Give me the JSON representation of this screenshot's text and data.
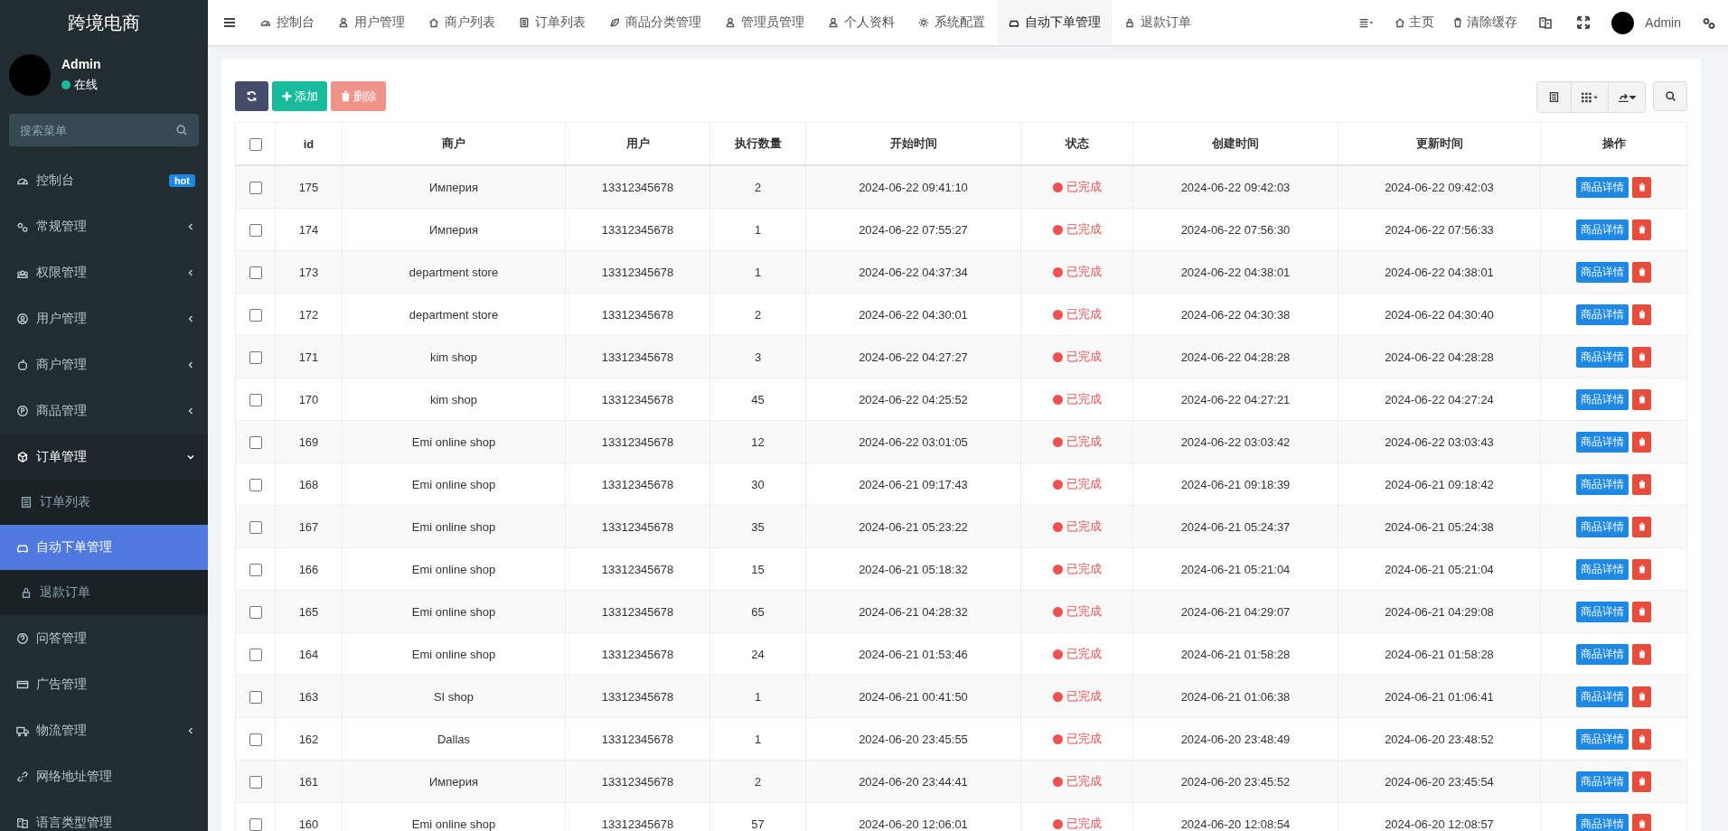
{
  "sidebar": {
    "logo": "跨境电商",
    "user": {
      "name": "Admin",
      "status": "在线",
      "online": true
    },
    "search": {
      "placeholder": "搜索菜单"
    },
    "items": [
      {
        "label": "控制台",
        "kind": "link",
        "badge": "hot"
      },
      {
        "label": "常规管理",
        "kind": "group",
        "expanded": false
      },
      {
        "label": "权限管理",
        "kind": "group",
        "expanded": false
      },
      {
        "label": "用户管理",
        "kind": "group",
        "expanded": false
      },
      {
        "label": "商户管理",
        "kind": "group",
        "expanded": false
      },
      {
        "label": "商品管理",
        "kind": "group",
        "expanded": false
      },
      {
        "label": "订单管理",
        "kind": "group",
        "expanded": true,
        "children": [
          {
            "label": "订单列表",
            "selected": false
          },
          {
            "label": "自动下单管理",
            "selected": true
          },
          {
            "label": "退款订单",
            "selected": false
          }
        ]
      },
      {
        "label": "问答管理",
        "kind": "link"
      },
      {
        "label": "广告管理",
        "kind": "link"
      },
      {
        "label": "物流管理",
        "kind": "group",
        "expanded": false
      },
      {
        "label": "网络地址管理",
        "kind": "link"
      },
      {
        "label": "语言类型管理",
        "kind": "link"
      }
    ]
  },
  "tabs": [
    {
      "label": "控制台",
      "selected": false
    },
    {
      "label": "用户管理",
      "selected": false
    },
    {
      "label": "商户列表",
      "selected": false
    },
    {
      "label": "订单列表",
      "selected": false
    },
    {
      "label": "商品分类管理",
      "selected": false
    },
    {
      "label": "管理员管理",
      "selected": false
    },
    {
      "label": "个人资料",
      "selected": false
    },
    {
      "label": "系统配置",
      "selected": false
    },
    {
      "label": "自动下单管理",
      "selected": true
    },
    {
      "label": "退款订单",
      "selected": false
    }
  ],
  "topbar": {
    "home": "主页",
    "clear_cache": "清除缓存",
    "user": "Admin"
  },
  "toolbar": {
    "add": "添加",
    "delete": {
      "label": "删除",
      "disabled": true
    }
  },
  "table": {
    "all_selected": false,
    "columns": [
      "id",
      "商户",
      "用户",
      "执行数量",
      "开始时间",
      "状态",
      "创建时间",
      "更新时间",
      "操作"
    ],
    "rows": [
      {
        "selected": false,
        "id": "175",
        "merchant": "Империя",
        "user": "13312345678",
        "count": "2",
        "start": "2024-06-22 09:41:10",
        "status": {
          "text": "已完成",
          "color": "#f05050"
        },
        "created": "2024-06-22 09:42:03",
        "updated": "2024-06-22 09:42:03",
        "detail": "商品详情"
      },
      {
        "selected": false,
        "id": "174",
        "merchant": "Империя",
        "user": "13312345678",
        "count": "1",
        "start": "2024-06-22 07:55:27",
        "status": {
          "text": "已完成",
          "color": "#f05050"
        },
        "created": "2024-06-22 07:56:30",
        "updated": "2024-06-22 07:56:33",
        "detail": "商品详情"
      },
      {
        "selected": false,
        "id": "173",
        "merchant": "department store",
        "user": "13312345678",
        "count": "1",
        "start": "2024-06-22 04:37:34",
        "status": {
          "text": "已完成",
          "color": "#f05050"
        },
        "created": "2024-06-22 04:38:01",
        "updated": "2024-06-22 04:38:01",
        "detail": "商品详情"
      },
      {
        "selected": false,
        "id": "172",
        "merchant": "department store",
        "user": "13312345678",
        "count": "2",
        "start": "2024-06-22 04:30:01",
        "status": {
          "text": "已完成",
          "color": "#f05050"
        },
        "created": "2024-06-22 04:30:38",
        "updated": "2024-06-22 04:30:40",
        "detail": "商品详情"
      },
      {
        "selected": false,
        "id": "171",
        "merchant": "kim shop",
        "user": "13312345678",
        "count": "3",
        "start": "2024-06-22 04:27:27",
        "status": {
          "text": "已完成",
          "color": "#f05050"
        },
        "created": "2024-06-22 04:28:28",
        "updated": "2024-06-22 04:28:28",
        "detail": "商品详情"
      },
      {
        "selected": false,
        "id": "170",
        "merchant": "kim shop",
        "user": "13312345678",
        "count": "45",
        "start": "2024-06-22 04:25:52",
        "status": {
          "text": "已完成",
          "color": "#f05050"
        },
        "created": "2024-06-22 04:27:21",
        "updated": "2024-06-22 04:27:24",
        "detail": "商品详情"
      },
      {
        "selected": false,
        "id": "169",
        "merchant": "Emi online shop",
        "user": "13312345678",
        "count": "12",
        "start": "2024-06-22 03:01:05",
        "status": {
          "text": "已完成",
          "color": "#f05050"
        },
        "created": "2024-06-22 03:03:42",
        "updated": "2024-06-22 03:03:43",
        "detail": "商品详情"
      },
      {
        "selected": false,
        "id": "168",
        "merchant": "Emi online shop",
        "user": "13312345678",
        "count": "30",
        "start": "2024-06-21 09:17:43",
        "status": {
          "text": "已完成",
          "color": "#f05050"
        },
        "created": "2024-06-21 09:18:39",
        "updated": "2024-06-21 09:18:42",
        "detail": "商品详情"
      },
      {
        "selected": false,
        "id": "167",
        "merchant": "Emi online shop",
        "user": "13312345678",
        "count": "35",
        "start": "2024-06-21 05:23:22",
        "status": {
          "text": "已完成",
          "color": "#f05050"
        },
        "created": "2024-06-21 05:24:37",
        "updated": "2024-06-21 05:24:38",
        "detail": "商品详情"
      },
      {
        "selected": false,
        "id": "166",
        "merchant": "Emi online shop",
        "user": "13312345678",
        "count": "15",
        "start": "2024-06-21 05:18:32",
        "status": {
          "text": "已完成",
          "color": "#f05050"
        },
        "created": "2024-06-21 05:21:04",
        "updated": "2024-06-21 05:21:04",
        "detail": "商品详情"
      },
      {
        "selected": false,
        "id": "165",
        "merchant": "Emi online shop",
        "user": "13312345678",
        "count": "65",
        "start": "2024-06-21 04:28:32",
        "status": {
          "text": "已完成",
          "color": "#f05050"
        },
        "created": "2024-06-21 04:29:07",
        "updated": "2024-06-21 04:29:08",
        "detail": "商品详情"
      },
      {
        "selected": false,
        "id": "164",
        "merchant": "Emi online shop",
        "user": "13312345678",
        "count": "24",
        "start": "2024-06-21 01:53:46",
        "status": {
          "text": "已完成",
          "color": "#f05050"
        },
        "created": "2024-06-21 01:58:28",
        "updated": "2024-06-21 01:58:28",
        "detail": "商品详情"
      },
      {
        "selected": false,
        "id": "163",
        "merchant": "SI shop",
        "user": "13312345678",
        "count": "1",
        "start": "2024-06-21 00:41:50",
        "status": {
          "text": "已完成",
          "color": "#f05050"
        },
        "created": "2024-06-21 01:06:38",
        "updated": "2024-06-21 01:06:41",
        "detail": "商品详情"
      },
      {
        "selected": false,
        "id": "162",
        "merchant": "Dallas",
        "user": "13312345678",
        "count": "1",
        "start": "2024-06-20 23:45:55",
        "status": {
          "text": "已完成",
          "color": "#f05050"
        },
        "created": "2024-06-20 23:48:49",
        "updated": "2024-06-20 23:48:52",
        "detail": "商品详情"
      },
      {
        "selected": false,
        "id": "161",
        "merchant": "Империя",
        "user": "13312345678",
        "count": "2",
        "start": "2024-06-20 23:44:41",
        "status": {
          "text": "已完成",
          "color": "#f05050"
        },
        "created": "2024-06-20 23:45:52",
        "updated": "2024-06-20 23:45:54",
        "detail": "商品详情"
      },
      {
        "selected": false,
        "id": "160",
        "merchant": "Emi online shop",
        "user": "13312345678",
        "count": "57",
        "start": "2024-06-20 12:06:01",
        "status": {
          "text": "已完成",
          "color": "#f05050"
        },
        "created": "2024-06-20 12:08:54",
        "updated": "2024-06-20 12:08:57",
        "detail": "商品详情"
      }
    ]
  }
}
